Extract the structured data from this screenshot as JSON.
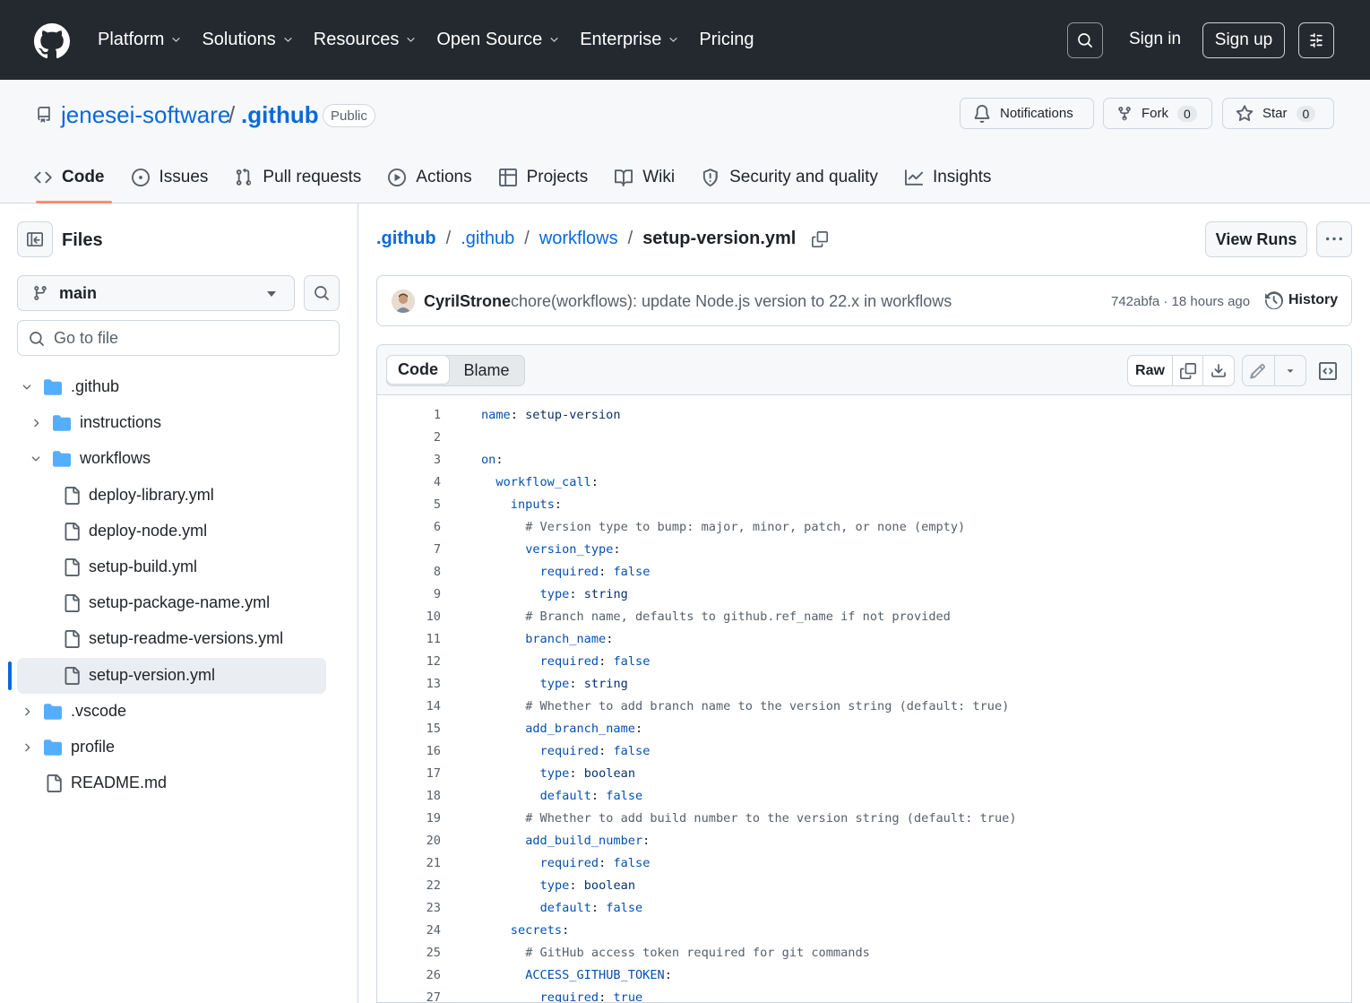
{
  "topnav": {
    "items": [
      {
        "label": "Platform",
        "dropdown": true
      },
      {
        "label": "Solutions",
        "dropdown": true
      },
      {
        "label": "Resources",
        "dropdown": true
      },
      {
        "label": "Open Source",
        "dropdown": true
      },
      {
        "label": "Enterprise",
        "dropdown": true
      },
      {
        "label": "Pricing",
        "dropdown": false
      }
    ],
    "signin": "Sign in",
    "signup": "Sign up"
  },
  "repo": {
    "owner": "jenesei-software",
    "slash": "/",
    "name": ".github",
    "visibility": "Public",
    "notifications": "Notifications",
    "fork_label": "Fork",
    "fork_count": "0",
    "star_label": "Star",
    "star_count": "0"
  },
  "tabs": [
    {
      "label": "Code",
      "icon": "code-icon",
      "active": true
    },
    {
      "label": "Issues",
      "icon": "issue-icon"
    },
    {
      "label": "Pull requests",
      "icon": "pull-request-icon"
    },
    {
      "label": "Actions",
      "icon": "play-icon"
    },
    {
      "label": "Projects",
      "icon": "table-icon"
    },
    {
      "label": "Wiki",
      "icon": "book-icon"
    },
    {
      "label": "Security and quality",
      "icon": "shield-icon"
    },
    {
      "label": "Insights",
      "icon": "graph-icon"
    }
  ],
  "sidebar": {
    "title": "Files",
    "branch": "main",
    "goto_placeholder": "Go to file",
    "tree": [
      {
        "label": ".github",
        "type": "folder",
        "expanded": true
      },
      {
        "label": "instructions",
        "type": "folder",
        "expanded": false
      },
      {
        "label": "workflows",
        "type": "folder",
        "expanded": true
      },
      {
        "label": "deploy-library.yml",
        "type": "file"
      },
      {
        "label": "deploy-node.yml",
        "type": "file"
      },
      {
        "label": "setup-build.yml",
        "type": "file"
      },
      {
        "label": "setup-package-name.yml",
        "type": "file"
      },
      {
        "label": "setup-readme-versions.yml",
        "type": "file"
      },
      {
        "label": "setup-version.yml",
        "type": "file",
        "selected": true
      },
      {
        "label": ".vscode",
        "type": "folder",
        "expanded": false
      },
      {
        "label": "profile",
        "type": "folder",
        "expanded": false
      },
      {
        "label": "README.md",
        "type": "file"
      }
    ]
  },
  "breadcrumb": {
    "parts": [
      ".github",
      ".github",
      "workflows"
    ],
    "current": "setup-version.yml"
  },
  "view_runs": "View Runs",
  "commit": {
    "author": "CyrilStrone",
    "message": "chore(workflows): update Node.js version to 22.x in workflows",
    "meta": "742abfa · 18 hours ago",
    "history": "History"
  },
  "code_view": {
    "tab_code": "Code",
    "tab_blame": "Blame",
    "raw": "Raw"
  },
  "code_lines": [
    {
      "n": "1",
      "indent": 0,
      "key": "name",
      "sep": ": ",
      "val": "setup-version",
      "vtype": "str"
    },
    {
      "n": "2",
      "indent": 0
    },
    {
      "n": "3",
      "indent": 0,
      "key": "on",
      "sep": ":"
    },
    {
      "n": "4",
      "indent": 2,
      "key": "workflow_call",
      "sep": ":"
    },
    {
      "n": "5",
      "indent": 4,
      "key": "inputs",
      "sep": ":"
    },
    {
      "n": "6",
      "indent": 6,
      "comment": "# Version type to bump: major, minor, patch, or none (empty)"
    },
    {
      "n": "7",
      "indent": 6,
      "key": "version_type",
      "sep": ":"
    },
    {
      "n": "8",
      "indent": 8,
      "key": "required",
      "sep": ": ",
      "val": "false",
      "vtype": "kw"
    },
    {
      "n": "9",
      "indent": 8,
      "key": "type",
      "sep": ": ",
      "val": "string",
      "vtype": "str"
    },
    {
      "n": "10",
      "indent": 6,
      "comment": "# Branch name, defaults to github.ref_name if not provided"
    },
    {
      "n": "11",
      "indent": 6,
      "key": "branch_name",
      "sep": ":"
    },
    {
      "n": "12",
      "indent": 8,
      "key": "required",
      "sep": ": ",
      "val": "false",
      "vtype": "kw"
    },
    {
      "n": "13",
      "indent": 8,
      "key": "type",
      "sep": ": ",
      "val": "string",
      "vtype": "str"
    },
    {
      "n": "14",
      "indent": 6,
      "comment": "# Whether to add branch name to the version string (default: true)"
    },
    {
      "n": "15",
      "indent": 6,
      "key": "add_branch_name",
      "sep": ":"
    },
    {
      "n": "16",
      "indent": 8,
      "key": "required",
      "sep": ": ",
      "val": "false",
      "vtype": "kw"
    },
    {
      "n": "17",
      "indent": 8,
      "key": "type",
      "sep": ": ",
      "val": "boolean",
      "vtype": "str"
    },
    {
      "n": "18",
      "indent": 8,
      "key": "default",
      "sep": ": ",
      "val": "false",
      "vtype": "kw"
    },
    {
      "n": "19",
      "indent": 6,
      "comment": "# Whether to add build number to the version string (default: true)"
    },
    {
      "n": "20",
      "indent": 6,
      "key": "add_build_number",
      "sep": ":"
    },
    {
      "n": "21",
      "indent": 8,
      "key": "required",
      "sep": ": ",
      "val": "false",
      "vtype": "kw"
    },
    {
      "n": "22",
      "indent": 8,
      "key": "type",
      "sep": ": ",
      "val": "boolean",
      "vtype": "str"
    },
    {
      "n": "23",
      "indent": 8,
      "key": "default",
      "sep": ": ",
      "val": "false",
      "vtype": "kw"
    },
    {
      "n": "24",
      "indent": 4,
      "key": "secrets",
      "sep": ":"
    },
    {
      "n": "25",
      "indent": 6,
      "comment": "# GitHub access token required for git commands"
    },
    {
      "n": "26",
      "indent": 6,
      "key": "ACCESS_GITHUB_TOKEN",
      "sep": ":"
    },
    {
      "n": "27",
      "indent": 8,
      "key": "required",
      "sep": ": ",
      "val": "true",
      "vtype": "kw"
    }
  ]
}
